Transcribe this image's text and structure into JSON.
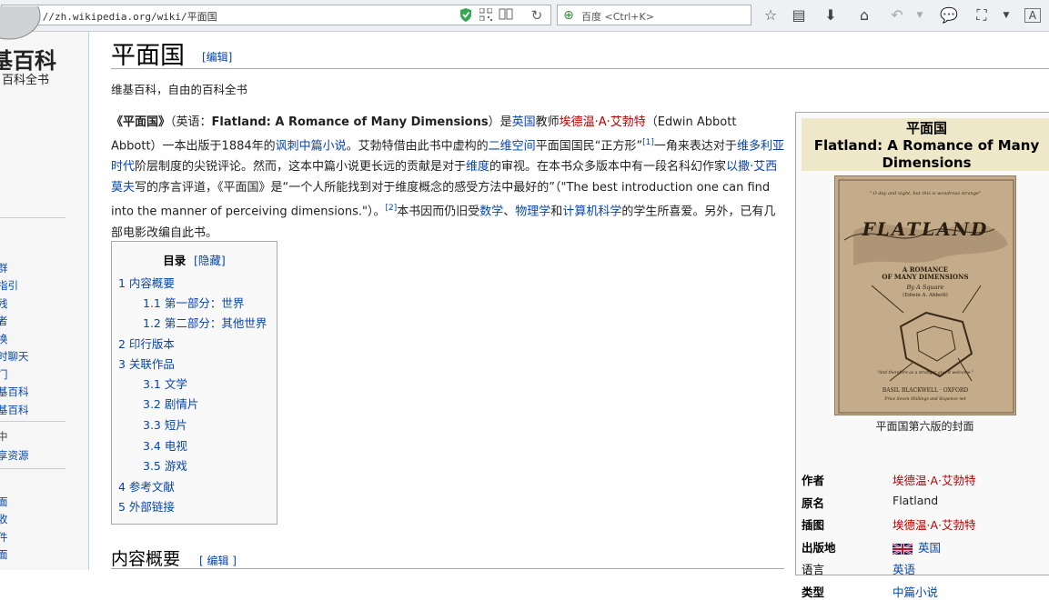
{
  "browser": {
    "url": "https://zh.wikipedia.org/wiki/平面国",
    "search_placeholder": "百度 <Ctrl+K>"
  },
  "sidebar": {
    "logo_line1": "基百科",
    "logo_line2": "百科全书",
    "items": [
      "群",
      "指引",
      "残",
      "者",
      "换",
      "时聊天",
      "门",
      "基百科",
      "基百科"
    ],
    "gray_items": [
      "中"
    ],
    "items2": [
      "享资源"
    ],
    "items3": [
      "面",
      "收",
      "件",
      "面"
    ]
  },
  "article": {
    "title": "平面国",
    "edit_label": "[编辑]",
    "tagline": "维基百科，自由的百科全书",
    "intro": {
      "t1": "《平面国》",
      "t2": "（英语：",
      "t3": "Flatland: A Romance of Many Dimensions",
      "t4": "）是",
      "l_england": "英国",
      "t5": "教师",
      "l_author": "埃德温·A·艾勃特",
      "t6": "（Edwin Abbott Abbott）一本出版于1884年的",
      "l_satire": "讽刺中篇小说",
      "t7": "。艾勃特借由此书中虚构的",
      "l_2d": "二维空间",
      "t8": "平面国国民“正方形”",
      "ref1": "[1]",
      "t9": "一角来表达对于",
      "l_victorian": "维多利亚时代",
      "t10": "阶层制度的尖锐评论。然而，这本中篇小说更长远的贡献是对于",
      "l_dimension": "维度",
      "t11": "的审视。在本书众多版本中有一段名科幻作家",
      "l_asimov": "以撒·艾西莫夫",
      "t12": "写的序言评道，《平面国》是“一个人所能找到对于维度概念的感受方法中最好的”（\"The best introduction one can find into the manner of perceiving dimensions.\"）。",
      "ref2": "[2]",
      "t13": "本书因而仍旧受",
      "l_math": "数学",
      "t14": "、",
      "l_physics": "物理学",
      "t15": "和",
      "l_cs": "计算机科学",
      "t16": "的学生所喜爱。另外，已有几部电影改编自此书。"
    },
    "toc": {
      "title": "目录",
      "toggle": "[隐藏]",
      "items": [
        "1 内容概要",
        "1.1 第一部分：世界",
        "1.2 第二部分：其他世界",
        "2 印行版本",
        "3 关联作品",
        "3.1 文学",
        "3.2 剧情片",
        "3.3 短片",
        "3.4 电视",
        "3.5 游戏",
        "4 参考文献",
        "5 外部链接"
      ]
    },
    "section": {
      "title": "内容概要",
      "edit_label": "[ 编辑 ]"
    }
  },
  "infobox": {
    "title_zh": "平面国",
    "title_en": "Flatland: A Romance of Many Dimensions",
    "caption": "平面国第六版的封面",
    "cover": {
      "quote_top": "\" O day and night, but this is wondrous strange\"",
      "title": "FLATLAND",
      "subtitle1": "A ROMANCE",
      "subtitle2": "OF MANY DIMENSIONS",
      "by": "By A Square",
      "author": "(Edwin A. Abbott)",
      "quote_bottom": "\"And therefore as a stranger give it welcome.\"",
      "publisher": "BASIL BLACKWELL · OXFORD",
      "price": "Price Seven Shillings and Sixpence net"
    },
    "rows": [
      {
        "label": "作者",
        "value": "埃德温·A·艾勃特",
        "kind": "red"
      },
      {
        "label": "原名",
        "value": "Flatland",
        "kind": "plain"
      },
      {
        "label": "插图",
        "value": "埃德温·A·艾勃特",
        "kind": "red"
      },
      {
        "label": "出版地",
        "value": "英国",
        "kind": "link"
      },
      {
        "label": "语言",
        "value": "英语",
        "kind": "link"
      },
      {
        "label": "类型",
        "value": "中篇小说",
        "kind": "link"
      }
    ]
  },
  "colors": {
    "link": "#0645ad",
    "redlink": "#ba0000",
    "infobox_header": "#eee8c9"
  }
}
